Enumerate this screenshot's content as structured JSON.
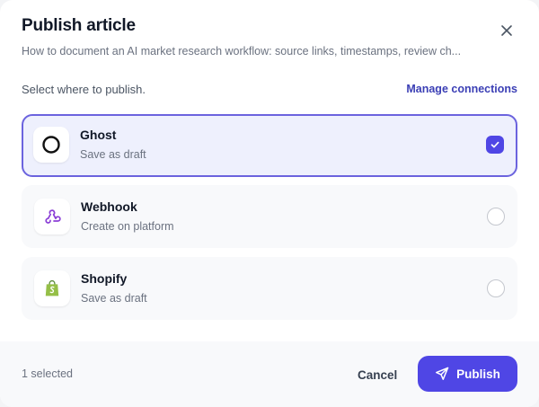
{
  "modal": {
    "title": "Publish article",
    "subtitle": "How to document an AI market research workflow: source links, timestamps, review ch...",
    "select_label": "Select where to publish.",
    "manage_link": "Manage connections"
  },
  "options": [
    {
      "name": "Ghost",
      "description": "Save as draft",
      "icon": "ghost-icon",
      "selected": true
    },
    {
      "name": "Webhook",
      "description": "Create on platform",
      "icon": "webhook-icon",
      "selected": false
    },
    {
      "name": "Shopify",
      "description": "Save as draft",
      "icon": "shopify-icon",
      "selected": false
    }
  ],
  "footer": {
    "selected_count": "1 selected",
    "cancel_label": "Cancel",
    "publish_label": "Publish"
  },
  "colors": {
    "accent": "#4f46e5",
    "selected_border": "#6b63de",
    "selected_bg": "#eef0fd",
    "webhook_icon": "#8b3fd6",
    "shopify_icon": "#95bf47"
  }
}
